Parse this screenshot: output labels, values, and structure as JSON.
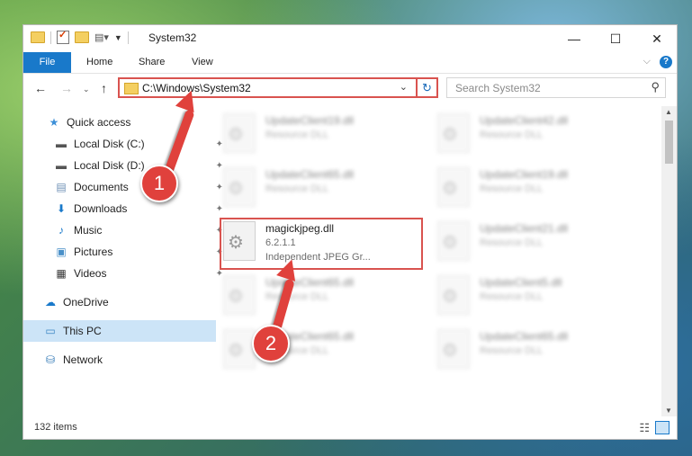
{
  "window": {
    "title": "System32",
    "controls": {
      "minimize": "—",
      "maximize": "☐",
      "close": "✕"
    }
  },
  "ribbon": {
    "tabs": [
      {
        "label": "File"
      },
      {
        "label": "Home"
      },
      {
        "label": "Share"
      },
      {
        "label": "View"
      }
    ],
    "expand": "⌵",
    "help": "?"
  },
  "navigation": {
    "back": "←",
    "forward": "→",
    "recent": "⌄",
    "up": "↑",
    "address": "C:\\Windows\\System32",
    "address_dropdown": "⌄",
    "refresh": "↻",
    "search_placeholder": "Search System32",
    "search_icon": "⚲"
  },
  "sidebar": {
    "items": [
      {
        "label": "Quick access",
        "icon": "star-icon",
        "glyph": "★"
      },
      {
        "label": "Local Disk (C:)",
        "icon": "disk-icon",
        "glyph": "▬",
        "pinned": true
      },
      {
        "label": "Local Disk (D:)",
        "icon": "disk-icon",
        "glyph": "▬",
        "pinned": true
      },
      {
        "label": "Documents",
        "icon": "documents-icon",
        "glyph": "▤",
        "pinned": true
      },
      {
        "label": "Downloads",
        "icon": "downloads-icon",
        "glyph": "⬇",
        "pinned": true
      },
      {
        "label": "Music",
        "icon": "music-icon",
        "glyph": "♪",
        "pinned": true
      },
      {
        "label": "Pictures",
        "icon": "pictures-icon",
        "glyph": "▣",
        "pinned": true
      },
      {
        "label": "Videos",
        "icon": "videos-icon",
        "glyph": "▦",
        "pinned": true
      },
      {
        "label": "OneDrive",
        "icon": "cloud-icon",
        "glyph": "☁"
      },
      {
        "label": "This PC",
        "icon": "computer-icon",
        "glyph": "▭",
        "selected": true
      },
      {
        "label": "Network",
        "icon": "network-icon",
        "glyph": "⛁"
      }
    ],
    "pin_glyph": "📌"
  },
  "files": [
    {
      "name": "UpdateClient19.dll",
      "desc": "Resource DLL"
    },
    {
      "name": "UpdateClient42.dll",
      "desc": "Resource DLL"
    },
    {
      "name": "UpdateClient65.dll",
      "desc": "Resource DLL"
    },
    {
      "name": "UpdateClient19.dll",
      "desc": "Resource DLL"
    },
    {
      "name": "magickjpeg.dll",
      "desc": "6.2.1.1",
      "sub": "Independent JPEG Gr..."
    },
    {
      "name": "UpdateClient21.dll",
      "desc": "Resource DLL"
    },
    {
      "name": "UpdateClient65.dll",
      "desc": "Resource DLL"
    },
    {
      "name": "UpdateClient5.dll",
      "desc": "Resource DLL"
    },
    {
      "name": "UpdateClient65.dll",
      "desc": "Resource DLL"
    },
    {
      "name": "UpdateClient65.dll",
      "desc": "Resource DLL"
    }
  ],
  "status": {
    "count": "132 items"
  },
  "annotations": {
    "badge1": "1",
    "badge2": "2",
    "color": "#e0413c"
  }
}
